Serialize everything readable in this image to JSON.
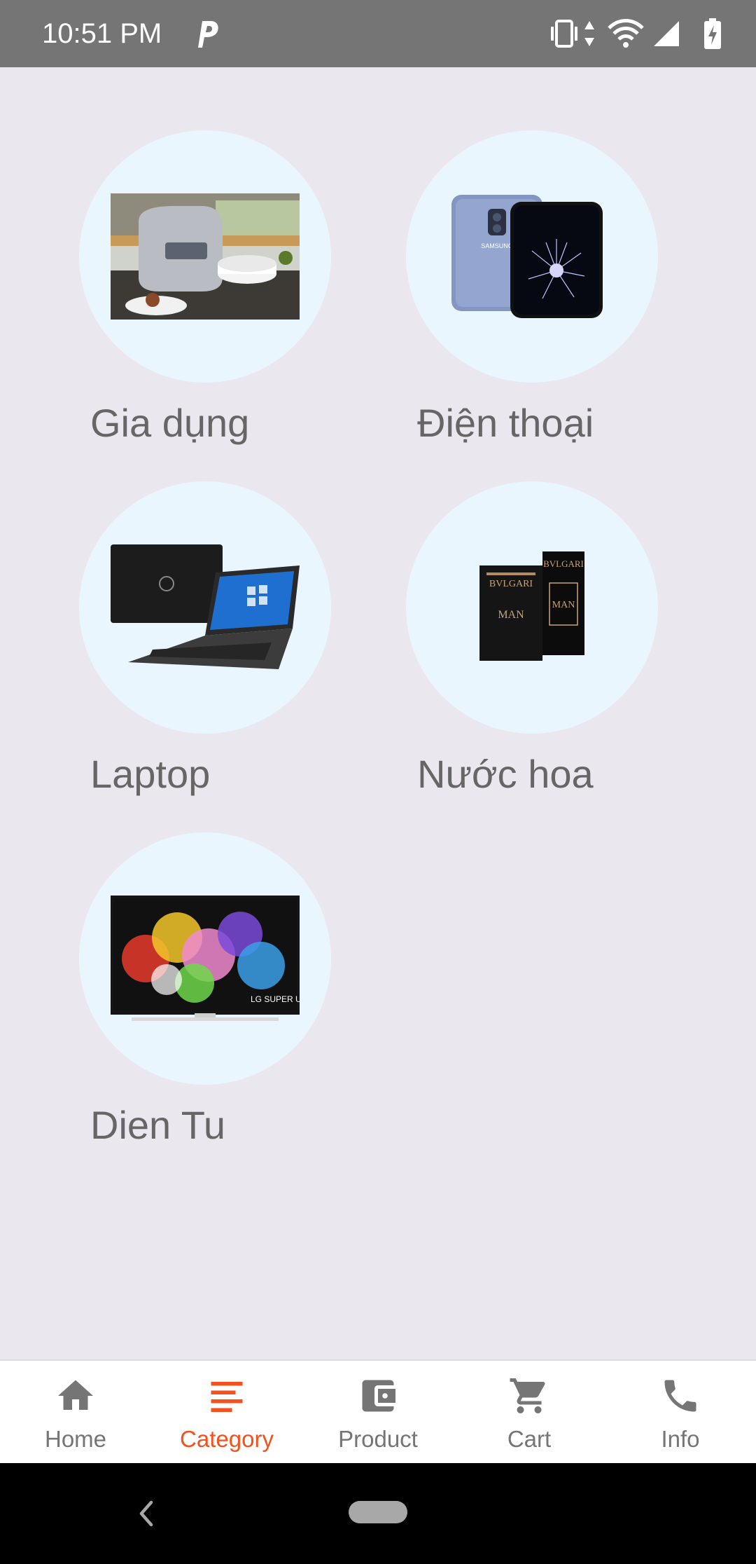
{
  "status_bar": {
    "time": "10:51 PM",
    "notification_icon": "p-icon",
    "icons": [
      "vibrate-icon",
      "data-arrows-icon",
      "wifi-icon",
      "signal-icon",
      "battery-charging-icon"
    ]
  },
  "categories": [
    {
      "label": "Gia dụng",
      "image": "rice-cooker-image"
    },
    {
      "label": "Điện thoại",
      "image": "smartphone-image"
    },
    {
      "label": "Laptop",
      "image": "laptop-image"
    },
    {
      "label": "Nước hoa",
      "image": "perfume-image"
    },
    {
      "label": "Dien Tu",
      "image": "tv-image"
    }
  ],
  "bottom_nav": {
    "items": [
      {
        "label": "Home",
        "icon": "home-icon"
      },
      {
        "label": "Category",
        "icon": "category-list-icon",
        "active": true
      },
      {
        "label": "Product",
        "icon": "wallet-icon"
      },
      {
        "label": "Cart",
        "icon": "cart-icon"
      },
      {
        "label": "Info",
        "icon": "phone-icon"
      }
    ]
  },
  "colors": {
    "status_bar": "#757575",
    "background": "#eae8ee",
    "circle": "#eaf6fe",
    "label": "#666666",
    "nav_inactive": "#757575",
    "nav_active": "#f4511e"
  },
  "system_nav": {
    "icons": [
      "back-icon",
      "home-pill-icon"
    ]
  }
}
